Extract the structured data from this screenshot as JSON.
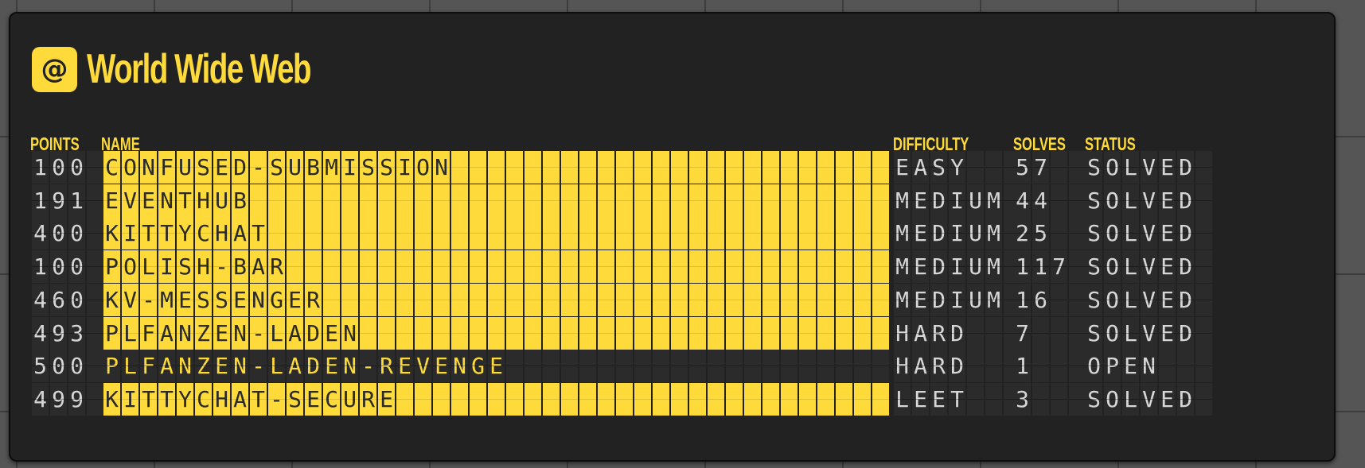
{
  "category": {
    "icon": "at-sign-icon",
    "icon_glyph": "@",
    "title": "World Wide Web"
  },
  "columns": {
    "points": "POINTS",
    "name": "NAME",
    "difficulty": "DIFFICULTY",
    "solves": "SOLVES",
    "status": "STATUS"
  },
  "challenges": [
    {
      "points": "100",
      "name": "CONFUSED-SUBMISSION",
      "difficulty": "EASY",
      "solves": "57",
      "status": "SOLVED"
    },
    {
      "points": "191",
      "name": "EVENTHUB",
      "difficulty": "MEDIUM",
      "solves": "44",
      "status": "SOLVED"
    },
    {
      "points": "400",
      "name": "KITTYCHAT",
      "difficulty": "MEDIUM",
      "solves": "25",
      "status": "SOLVED"
    },
    {
      "points": "100",
      "name": "POLISH-BAR",
      "difficulty": "MEDIUM",
      "solves": "117",
      "status": "SOLVED"
    },
    {
      "points": "460",
      "name": "KV-MESSENGER",
      "difficulty": "MEDIUM",
      "solves": "16",
      "status": "SOLVED"
    },
    {
      "points": "493",
      "name": "PLFANZEN-LADEN",
      "difficulty": "HARD",
      "solves": "7",
      "status": "SOLVED"
    },
    {
      "points": "500",
      "name": "PLFANZEN-LADEN-REVENGE",
      "difficulty": "HARD",
      "solves": "1",
      "status": "OPEN"
    },
    {
      "points": "499",
      "name": "KITTYCHAT-SECURE",
      "difficulty": "LEET",
      "solves": "3",
      "status": "SOLVED"
    }
  ],
  "colors": {
    "accent": "#fedb3b",
    "panel": "#222222",
    "cell": "#2b2b2b",
    "cell_text": "#d7d7d7"
  }
}
